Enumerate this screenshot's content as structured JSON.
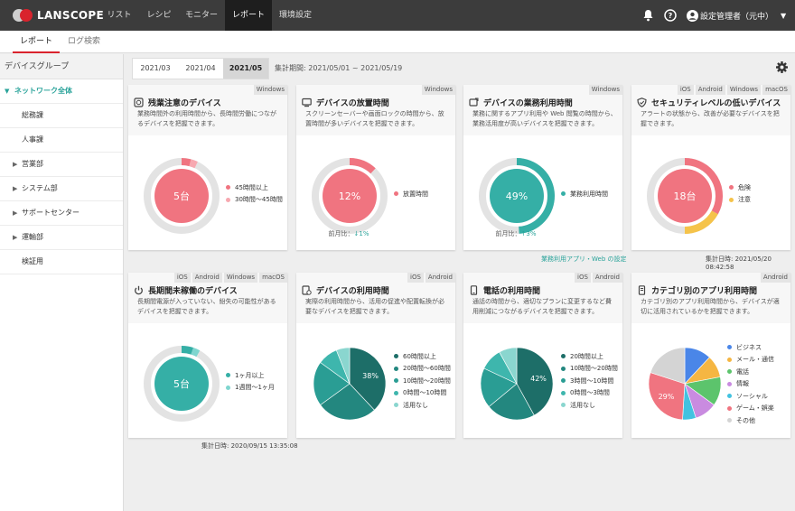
{
  "app": {
    "logo": "LANSCOPE"
  },
  "topnav": [
    {
      "label": "リスト"
    },
    {
      "label": "レシピ"
    },
    {
      "label": "モニター"
    },
    {
      "label": "レポート"
    },
    {
      "label": "環境設定"
    }
  ],
  "user": {
    "name": "設定管理者（元中）"
  },
  "subtabs": [
    {
      "label": "レポート"
    },
    {
      "label": "ログ検索"
    }
  ],
  "sidebar": {
    "title": "デバイスグループ",
    "items": [
      {
        "label": "ネットワーク全体"
      },
      {
        "label": "総務課"
      },
      {
        "label": "人事課"
      },
      {
        "label": "営業部"
      },
      {
        "label": "システム部"
      },
      {
        "label": "サポートセンター"
      },
      {
        "label": "運輸部"
      },
      {
        "label": "検証用"
      }
    ]
  },
  "months": [
    {
      "label": "2021/03"
    },
    {
      "label": "2021/04"
    },
    {
      "label": "2021/05"
    }
  ],
  "period": "集計期間: 2021/05/01 ~ 2021/05/19",
  "cards": [
    {
      "tags": [
        "Windows"
      ],
      "title": "残業注意のデバイス",
      "desc": "業務時間外の利用時間から、長時間労働につながるデバイスを把握できます。",
      "center": "5台",
      "legend": [
        "45時間以上",
        "30時間〜45時間"
      ],
      "values": [
        0.04,
        0.03
      ]
    },
    {
      "tags": [
        "Windows"
      ],
      "title": "デバイスの放置時間",
      "desc": "スクリーンセーバーや画面ロックの時間から、放置時間が多いデバイスを把握できます。",
      "center": "12%",
      "legend": [
        "放置時間"
      ],
      "values": [
        0.12
      ],
      "foot_prefix": "前月比：",
      "foot_value": "↓1%"
    },
    {
      "tags": [
        "Windows"
      ],
      "title": "デバイスの業務利用時間",
      "desc": "業務に関するアプリ利用や Web 閲覧の時間から、業務活用度が高いデバイスを把握できます。",
      "center": "49%",
      "legend": [
        "業務利用時間"
      ],
      "values": [
        0.49
      ],
      "foot_prefix": "前月比：",
      "foot_value": "↑3%"
    },
    {
      "tags": [
        "iOS",
        "Android",
        "Windows",
        "macOS"
      ],
      "title": "セキュリティレベルの低いデバイス",
      "desc": "アラートの状態から、改善が必要なデバイスを把握できます。",
      "center": "18台",
      "legend": [
        "危険",
        "注意"
      ],
      "values": [
        0.33,
        0.17
      ]
    },
    {
      "tags": [
        "iOS",
        "Android",
        "Windows",
        "macOS"
      ],
      "title": "長期間未稼働のデバイス",
      "desc": "長期間電源が入っていない、紛失の可能性があるデバイスを把握できます。",
      "center": "5台",
      "legend": [
        "1ヶ月以上",
        "1週間〜1ヶ月"
      ],
      "values": [
        0.05,
        0.03
      ]
    },
    {
      "tags": [
        "iOS",
        "Android"
      ],
      "title": "デバイスの利用時間",
      "desc": "実際の利用時間から、活用の促進や配置転換が必要なデバイスを把握できます。",
      "center": "38%",
      "legend": [
        "60時間以上",
        "20時間〜60時間",
        "10時間〜20時間",
        "0時間〜10時間",
        "活用なし"
      ],
      "values": [
        0.38,
        0.27,
        0.2,
        0.09,
        0.06
      ]
    },
    {
      "tags": [
        "iOS",
        "Android"
      ],
      "title": "電話の利用時間",
      "desc": "通話の時間から、適切なプランに変更するなど費用削減につながるデバイスを把握できます。",
      "center": "42%",
      "legend": [
        "20時間以上",
        "10時間〜20時間",
        "3時間〜10時間",
        "0時間〜3時間",
        "活用なし"
      ],
      "values": [
        0.42,
        0.22,
        0.18,
        0.1,
        0.08
      ]
    },
    {
      "tags": [
        "Android"
      ],
      "title": "カテゴリ別のアプリ利用時間",
      "desc": "カテゴリ別のアプリ利用時間から、デバイスが適切に活用されているかを把握できます。",
      "center": "29%",
      "legend": [
        "ビジネス",
        "メール・通信",
        "電話",
        "情報",
        "ソーシャル",
        "ゲーム・娯楽",
        "その他"
      ],
      "values": [
        0.12,
        0.1,
        0.13,
        0.1,
        0.06,
        0.29,
        0.2
      ]
    }
  ],
  "below_row1": {
    "link": "業務利用アプリ・Web の設定",
    "date": "集計日時: 2021/05/20 08:42:58"
  },
  "below_row2": {
    "date": "集計日時: 2020/09/15 13:35:08"
  },
  "colors": {
    "accent": "#2aa39a",
    "red": "#d9232d",
    "pink": "#f07480",
    "pinklight": "#f7a8b0",
    "teal": "#35afa6",
    "teallight": "#7fd6cf",
    "yellow": "#f5c34a",
    "track": "#e3e3e3"
  }
}
